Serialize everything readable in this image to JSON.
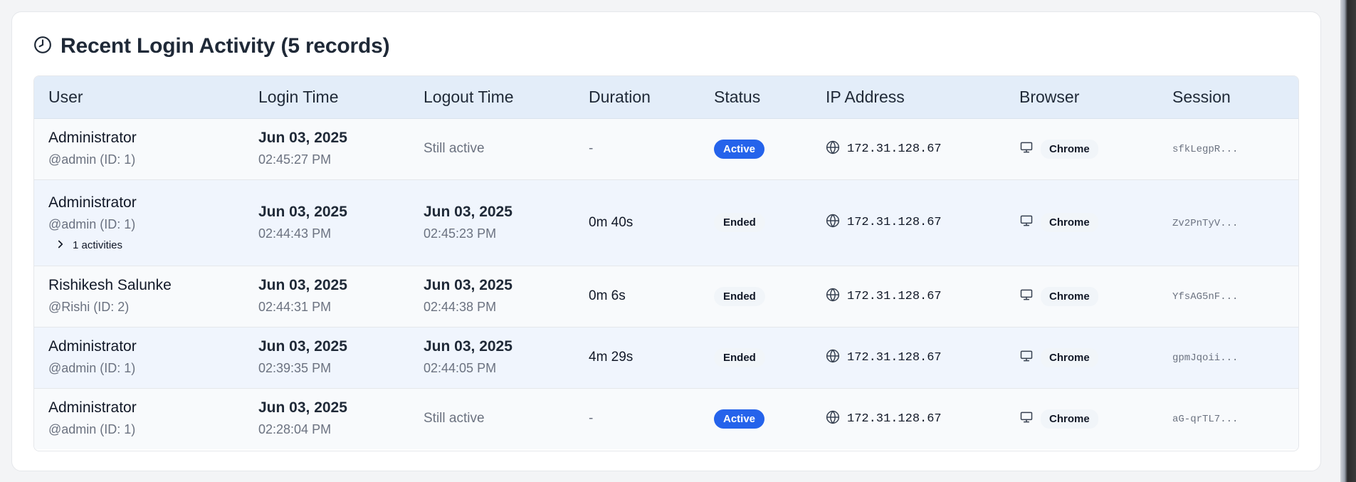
{
  "header": {
    "title": "Recent Login Activity (5 records)",
    "icon": "clock-icon"
  },
  "columns": [
    "User",
    "Login Time",
    "Logout Time",
    "Duration",
    "Status",
    "IP Address",
    "Browser",
    "Session"
  ],
  "rows": [
    {
      "user_name": "Administrator",
      "user_sub": "@admin (ID: 1)",
      "login_date": "Jun 03, 2025",
      "login_time": "02:45:27 PM",
      "logout_text": "Still active",
      "duration": "-",
      "status": "Active",
      "ip": "172.31.128.67",
      "browser": "Chrome",
      "session": "sfkLegpR..."
    },
    {
      "user_name": "Administrator",
      "user_sub": "@admin (ID: 1)",
      "activities_label": "1 activities",
      "login_date": "Jun 03, 2025",
      "login_time": "02:44:43 PM",
      "logout_date": "Jun 03, 2025",
      "logout_time": "02:45:23 PM",
      "duration": "0m 40s",
      "status": "Ended",
      "ip": "172.31.128.67",
      "browser": "Chrome",
      "session": "Zv2PnTyV..."
    },
    {
      "user_name": "Rishikesh Salunke",
      "user_sub": "@Rishi (ID: 2)",
      "login_date": "Jun 03, 2025",
      "login_time": "02:44:31 PM",
      "logout_date": "Jun 03, 2025",
      "logout_time": "02:44:38 PM",
      "duration": "0m 6s",
      "status": "Ended",
      "ip": "172.31.128.67",
      "browser": "Chrome",
      "session": "YfsAG5nF..."
    },
    {
      "user_name": "Administrator",
      "user_sub": "@admin (ID: 1)",
      "login_date": "Jun 03, 2025",
      "login_time": "02:39:35 PM",
      "logout_date": "Jun 03, 2025",
      "logout_time": "02:44:05 PM",
      "duration": "4m 29s",
      "status": "Ended",
      "ip": "172.31.128.67",
      "browser": "Chrome",
      "session": "gpmJqoii..."
    },
    {
      "user_name": "Administrator",
      "user_sub": "@admin (ID: 1)",
      "login_date": "Jun 03, 2025",
      "login_time": "02:28:04 PM",
      "logout_text": "Still active",
      "duration": "-",
      "status": "Active",
      "ip": "172.31.128.67",
      "browser": "Chrome",
      "session": "aG-qrTL7..."
    }
  ],
  "colors": {
    "active_badge": "#2563eb",
    "header_bg": "#e3edf9"
  }
}
